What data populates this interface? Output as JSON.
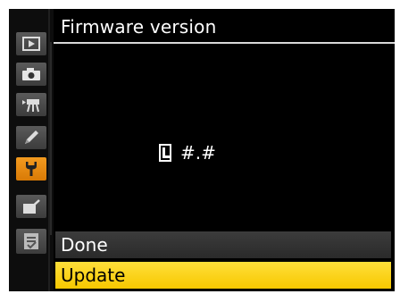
{
  "screen": {
    "title": "Firmware version",
    "version_text": "#.#",
    "menu": [
      {
        "label": "Done",
        "selected": false
      },
      {
        "label": "Update",
        "selected": true
      }
    ]
  },
  "sidebar": {
    "items": [
      {
        "icon": "playback-icon",
        "active": false
      },
      {
        "icon": "camera-icon",
        "active": false
      },
      {
        "icon": "movie-icon",
        "active": false
      },
      {
        "icon": "pencil-icon",
        "active": false
      },
      {
        "icon": "wrench-icon",
        "active": true
      },
      {
        "icon": "retouch-icon",
        "active": false
      },
      {
        "icon": "my-menu-icon",
        "active": false
      }
    ]
  },
  "colors": {
    "selected_highlight": "#f7c800",
    "active_tab": "#e88a10",
    "background": "#000000"
  }
}
